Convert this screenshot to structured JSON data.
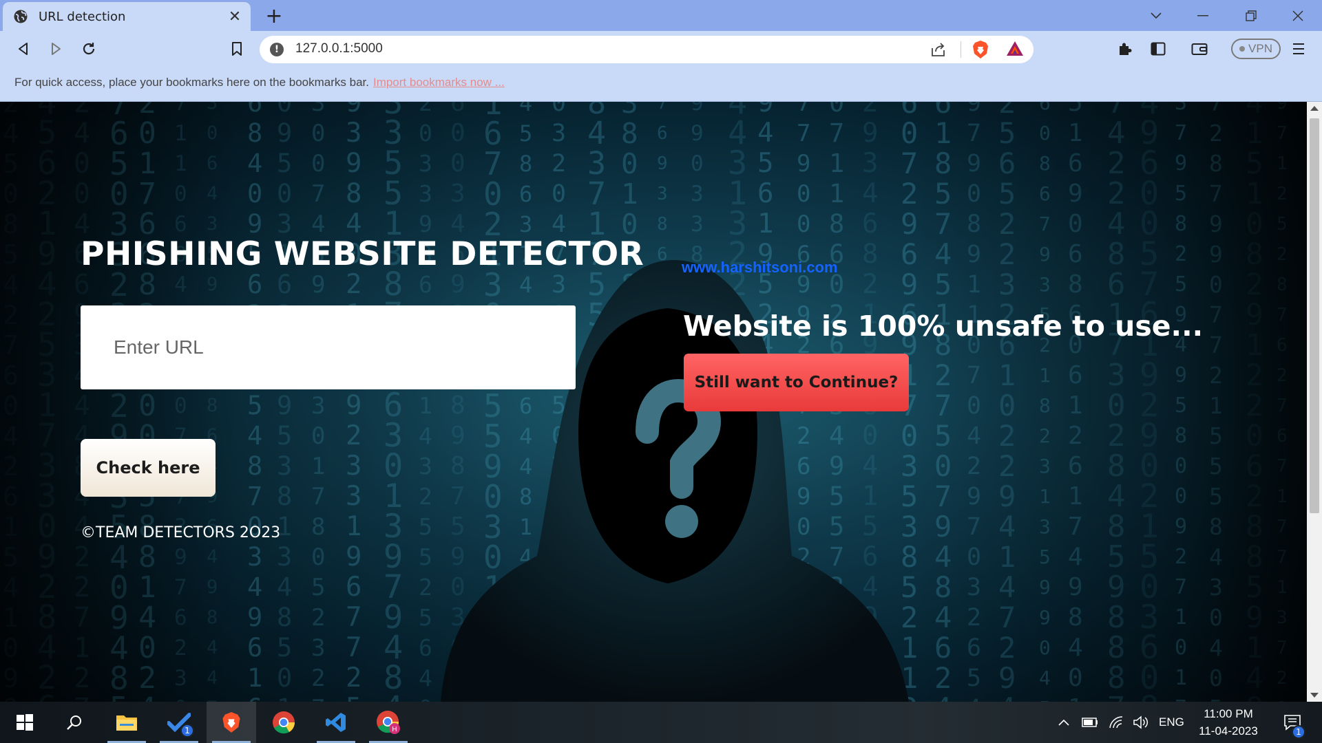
{
  "browser": {
    "tab_title": "URL detection",
    "new_tab_label": "+",
    "address": "127.0.0.1:5000",
    "vpn_label": "VPN",
    "bookmarks_message": "For quick access, place your bookmarks here on the bookmarks bar.",
    "import_link": "Import bookmarks now ..."
  },
  "page": {
    "heading": "PHISHING WEBSITE DETECTOR",
    "url_placeholder": "Enter URL",
    "url_value": "",
    "check_button": "Check here",
    "copyright": "©TEAM DETECTORS 2O23",
    "site_link": "www.harshitsoni.com",
    "result_text": "Website is 100% unsafe to use...",
    "continue_button": "Still want to Continue?"
  },
  "taskbar": {
    "apps": [
      "windows-start",
      "search",
      "file-explorer",
      "todo",
      "brave",
      "chrome",
      "vscode",
      "chrome-profile"
    ],
    "todo_badge": "1",
    "language": "ENG",
    "time": "11:00 PM",
    "date": "11-04-2023",
    "notification_badge": "1"
  },
  "colors": {
    "tab_bar": "#8aa8ea",
    "toolbar": "#c9d9f8",
    "site_link": "#1463ff",
    "continue_button": "#ef4444",
    "check_button": "#f5ede0"
  }
}
